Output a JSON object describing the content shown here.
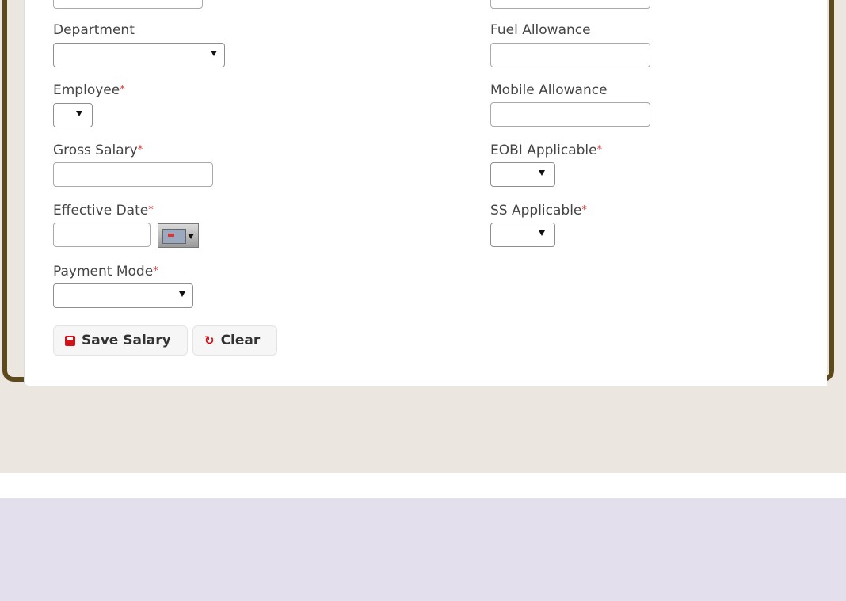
{
  "form": {
    "left": {
      "department_label": "Department",
      "employee_label": "Employee",
      "gross_salary_label": "Gross Salary",
      "effective_date_label": "Effective Date",
      "payment_mode_label": "Payment Mode"
    },
    "right": {
      "fuel_allowance_label": "Fuel Allowance",
      "mobile_allowance_label": "Mobile Allowance",
      "eobi_applicable_label": "EOBI Applicable",
      "ss_applicable_label": "SS Applicable"
    },
    "required_marker": "*"
  },
  "buttons": {
    "save_label": "Save Salary",
    "clear_label": "Clear",
    "clear_icon": "↻"
  },
  "colors": {
    "frame_border": "#5c4a1d",
    "required": "#e03a3a",
    "button_icon": "#d0121b",
    "page_background": "#ece6e1",
    "footer_band": "#e3dfed"
  }
}
